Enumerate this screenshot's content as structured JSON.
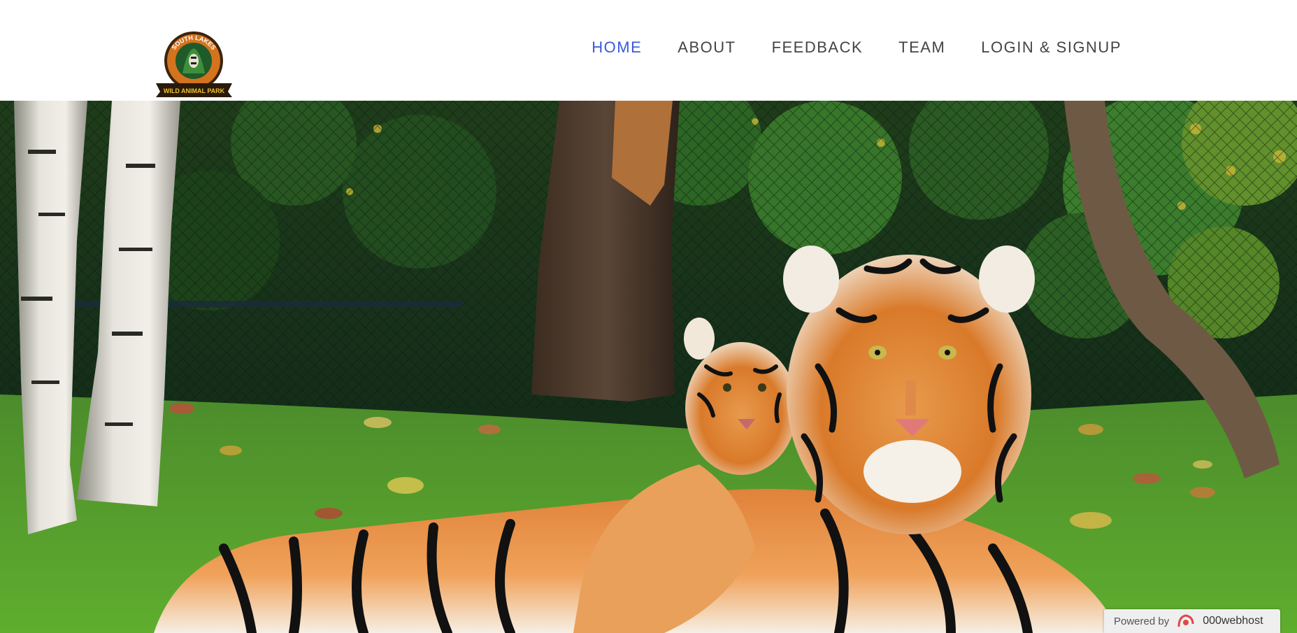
{
  "site": {
    "logo": {
      "top_text": "SOUTH LAKES",
      "ribbon_text": "WILD ANIMAL PARK"
    }
  },
  "nav": {
    "items": [
      {
        "label": "HOME",
        "active": true
      },
      {
        "label": "ABOUT",
        "active": false
      },
      {
        "label": "FEEDBACK",
        "active": false
      },
      {
        "label": "TEAM",
        "active": false
      },
      {
        "label": "LOGIN & SIGNUP",
        "active": false
      }
    ],
    "active_color": "#3a5bd9",
    "color": "#444444"
  },
  "hero": {
    "subject": "tiger-and-cub-photo"
  },
  "badge": {
    "powered_by": "Powered by",
    "brand": "000webhost",
    "brand_color": "#e04848"
  }
}
